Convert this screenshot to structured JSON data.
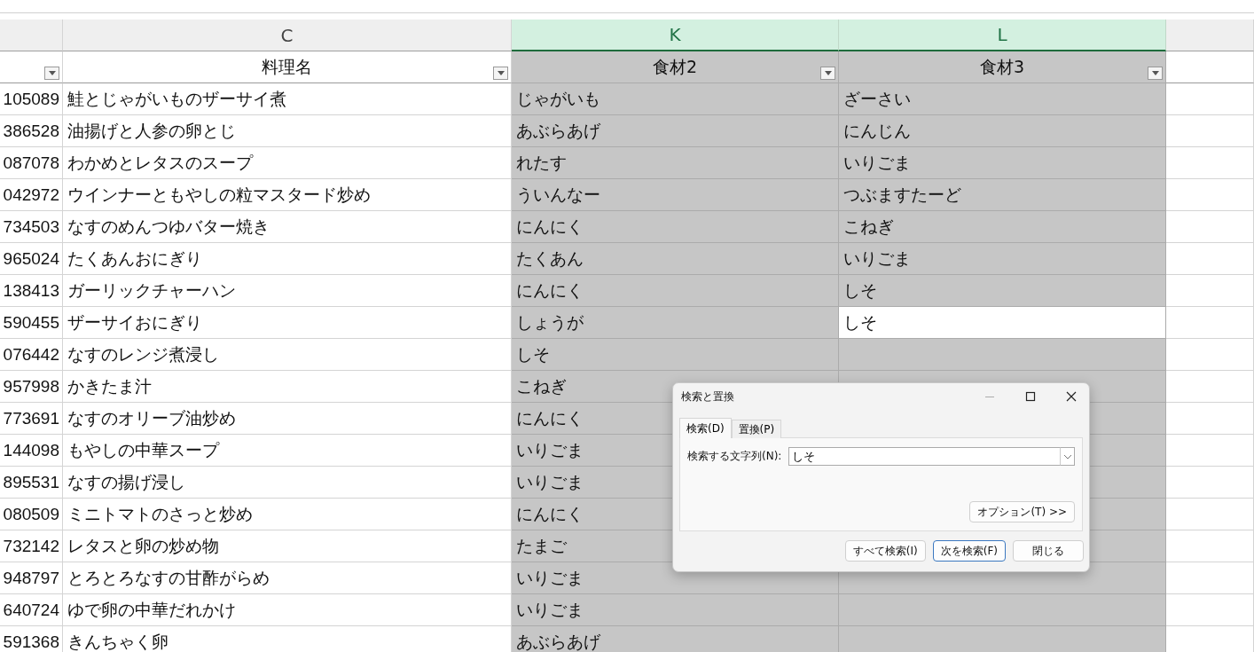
{
  "columns": [
    {
      "filter": true,
      "selected": false
    },
    {
      "letter": "C",
      "heading": "料理名",
      "filter": true,
      "selected": false
    },
    {
      "letter": "K",
      "heading": "食材2",
      "filter": true,
      "selected": true
    },
    {
      "letter": "L",
      "heading": "食材3",
      "filter": true,
      "selected": true
    },
    {
      "filter": false,
      "selected": false
    }
  ],
  "rows": [
    {
      "number": "105089",
      "dish": "鮭とじゃがいものザーサイ煮",
      "ingredient2": "じゃがいも",
      "ingredient3": "ざーさい",
      "active": false
    },
    {
      "number": "386528",
      "dish": "油揚げと人参の卵とじ",
      "ingredient2": "あぶらあげ",
      "ingredient3": "にんじん",
      "active": false
    },
    {
      "number": "087078",
      "dish": "わかめとレタスのスープ",
      "ingredient2": "れたす",
      "ingredient3": "いりごま",
      "active": false
    },
    {
      "number": "042972",
      "dish": "ウインナーともやしの粒マスタード炒め",
      "ingredient2": "ういんなー",
      "ingredient3": "つぶますたーど",
      "active": false
    },
    {
      "number": "734503",
      "dish": "なすのめんつゆバター焼き",
      "ingredient2": "にんにく",
      "ingredient3": "こねぎ",
      "active": false
    },
    {
      "number": "965024",
      "dish": "たくあんおにぎり",
      "ingredient2": "たくあん",
      "ingredient3": "いりごま",
      "active": false
    },
    {
      "number": "138413",
      "dish": "ガーリックチャーハン",
      "ingredient2": "にんにく",
      "ingredient3": "しそ",
      "active": false
    },
    {
      "number": "590455",
      "dish": "ザーサイおにぎり",
      "ingredient2": "しょうが",
      "ingredient3": "しそ",
      "active": true
    },
    {
      "number": "076442",
      "dish": "なすのレンジ煮浸し",
      "ingredient2": "しそ",
      "active": false
    },
    {
      "number": "957998",
      "dish": "かきたま汁",
      "ingredient2": "こねぎ",
      "active": false
    },
    {
      "number": "773691",
      "dish": "なすのオリーブ油炒め",
      "ingredient2": "にんにく",
      "active": false
    },
    {
      "number": "144098",
      "dish": "もやしの中華スープ",
      "ingredient2": "いりごま",
      "active": false
    },
    {
      "number": "895531",
      "dish": "なすの揚げ浸し",
      "ingredient2": "いりごま",
      "active": false
    },
    {
      "number": "080509",
      "dish": "ミニトマトのさっと炒め",
      "ingredient2": "にんにく",
      "active": false
    },
    {
      "number": "732142",
      "dish": "レタスと卵の炒め物",
      "ingredient2": "たまご",
      "active": false
    },
    {
      "number": "948797",
      "dish": "とろとろなすの甘酢がらめ",
      "ingredient2": "いりごま",
      "active": false
    },
    {
      "number": "640724",
      "dish": "ゆで卵の中華だれかけ",
      "ingredient2": "いりごま",
      "active": false
    },
    {
      "number": "591368",
      "dish": "きんちゃく卵",
      "ingredient2": "あぶらあげ",
      "active": false
    }
  ],
  "dialog": {
    "title": "検索と置換",
    "tabs": [
      {
        "label": "検索(D)",
        "selected": true
      },
      {
        "label": "置換(P)",
        "selected": false
      }
    ],
    "field_label": "検索する文字列(N):",
    "value": "しそ",
    "options_button": "オプション(T) >>",
    "buttons": [
      {
        "label": "すべて検索(I)",
        "default": false
      },
      {
        "label": "次を検索(F)",
        "default": true
      },
      {
        "label": "閉じる",
        "default": false
      }
    ]
  }
}
